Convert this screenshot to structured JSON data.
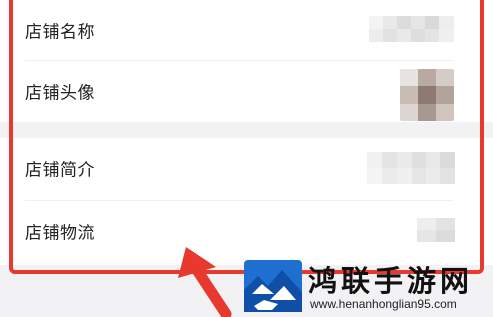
{
  "settings": {
    "rows": [
      {
        "label": "店铺名称",
        "value_kind": "text"
      },
      {
        "label": "店铺头像",
        "value_kind": "avatar"
      },
      {
        "label": "店铺简介",
        "value_kind": "text"
      },
      {
        "label": "店铺物流",
        "value_kind": "text"
      }
    ]
  },
  "annotation": {
    "highlight_color": "#e8392f"
  },
  "watermark": {
    "title": "鸿联手游网",
    "url": "www.henanhonglian95.com",
    "logo_color": "#1e6fd0"
  }
}
